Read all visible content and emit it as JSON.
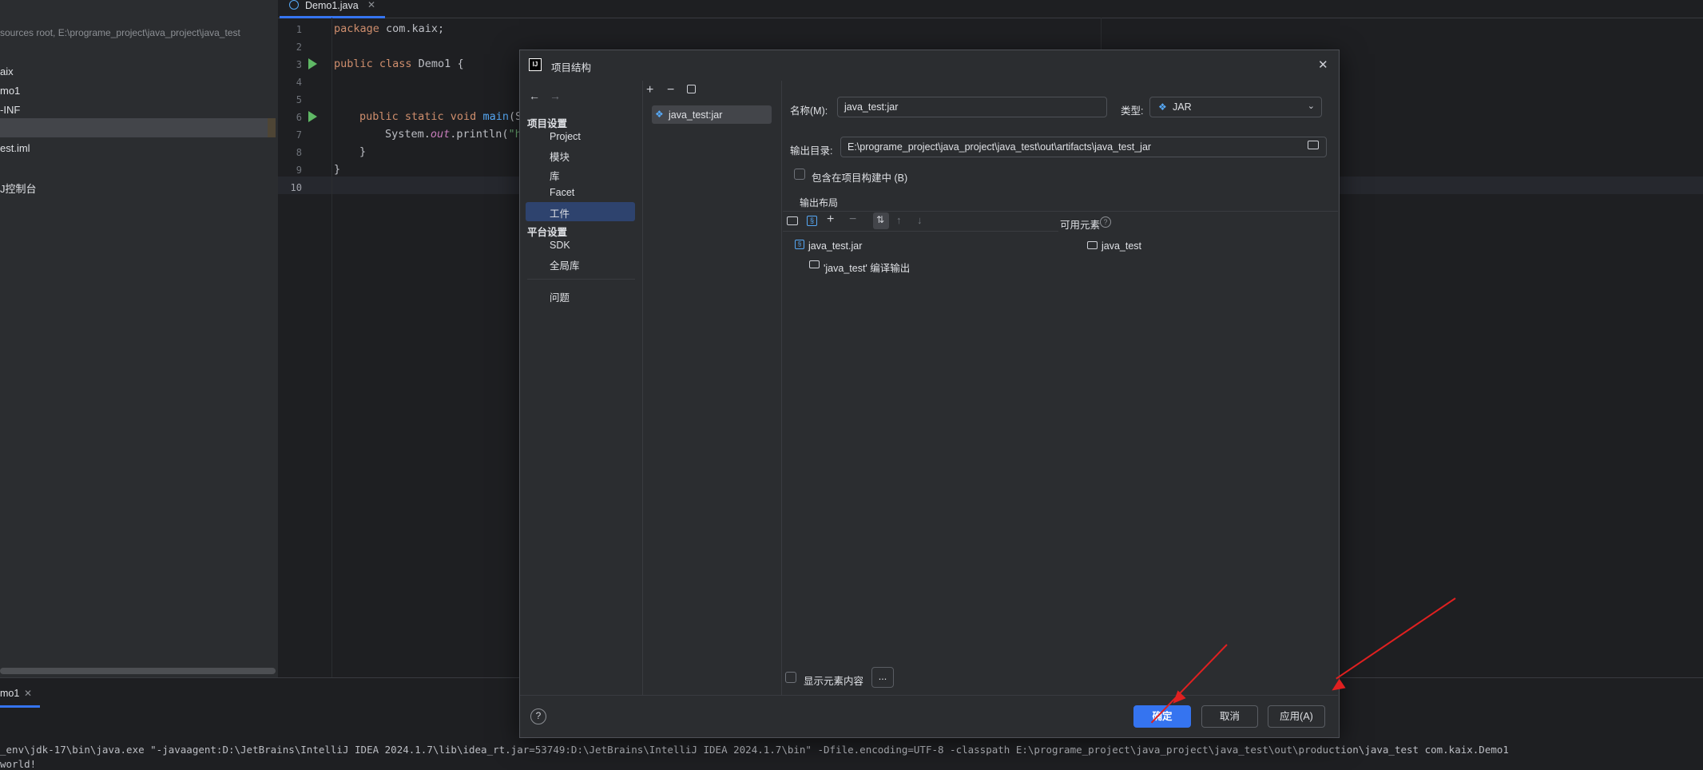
{
  "project_pane": {
    "root_hint": "sources root,  E:\\programe_project\\java_project\\java_test",
    "items": [
      "aix",
      "mo1",
      "-INF",
      "",
      "est.iml",
      "",
      "J控制台"
    ]
  },
  "editor": {
    "tab_label": "Demo1.java",
    "line_numbers": [
      "1",
      "2",
      "3",
      "4",
      "5",
      "6",
      "7",
      "8",
      "9",
      "10"
    ],
    "code": {
      "l1_kw": "package",
      "l1_rest": " com.kaix;",
      "l3_kw": "public class",
      "l3_rest": " Demo1 {",
      "l6_kw": "public static void",
      "l6_fn": " main",
      "l6_rest": "(S",
      "l7_a": "System.",
      "l7_it": "out",
      "l7_b": ".println(",
      "l7_str": "\"h",
      "l8": "}",
      "l9": "}"
    }
  },
  "run_panel": {
    "tab_label": "mo1",
    "command": "_env\\jdk-17\\bin\\java.exe \"-javaagent:D:\\JetBrains\\IntelliJ IDEA 2024.1.7\\lib\\idea_rt.jar=53749:D:\\JetBrains\\IntelliJ IDEA 2024.1.7\\bin\" -Dfile.encoding=UTF-8 -classpath E:\\programe_project\\java_project\\java_test\\out\\production\\java_test com.kaix.Demo1",
    "output": "world!"
  },
  "dialog": {
    "title": "项目结构",
    "nav": {
      "project_settings_header": "项目设置",
      "project_settings": [
        "Project",
        "模块",
        "库",
        "Facet",
        "工件"
      ],
      "platform_settings_header": "平台设置",
      "platform_settings": [
        "SDK",
        "全局库"
      ],
      "problems": "问题"
    },
    "artifact_list": [
      "java_test:jar"
    ],
    "name_label": "名称(M):",
    "name_value": "java_test:jar",
    "type_label": "类型:",
    "type_value": "JAR",
    "output_dir_label": "输出目录:",
    "output_dir_value": "E:\\programe_project\\java_project\\java_test\\out\\artifacts\\java_test_jar",
    "include_in_build_label": "包含在项目构建中 (B)",
    "output_layout_tab": "输出布局",
    "available_elements_label": "可用元素",
    "layout_tree": [
      "java_test.jar",
      "'java_test' 编译输出"
    ],
    "available_tree": [
      "java_test"
    ],
    "show_content_label": "显示元素内容",
    "more_button": "...",
    "ok_button": "确定",
    "cancel_button": "取消",
    "apply_button": "应用(A)",
    "help_icon": "?"
  },
  "annotation_color": "#e02020"
}
